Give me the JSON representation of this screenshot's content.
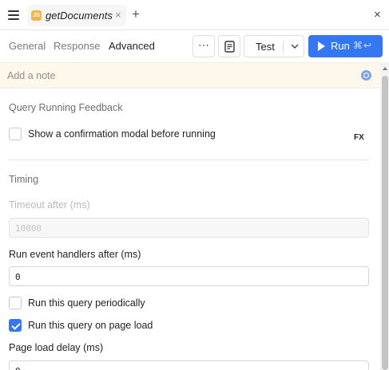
{
  "tab": {
    "badge": "JS",
    "title": "getDocuments",
    "close_glyph": "×",
    "add_glyph": "+",
    "panel_close_glyph": "×"
  },
  "toolbar": {
    "tabs": [
      {
        "label": "General",
        "active": false
      },
      {
        "label": "Response",
        "active": false
      },
      {
        "label": "Advanced",
        "active": true
      }
    ],
    "more_label": "⋯",
    "test_label": "Test",
    "run_label": "Run",
    "run_shortcut": "⌘↩"
  },
  "note": {
    "placeholder": "Add a note"
  },
  "feedback": {
    "title": "Query Running Feedback",
    "confirm_label": "Show a confirmation modal before running",
    "confirm_checked": false,
    "fx_label": "FX"
  },
  "timing": {
    "title": "Timing",
    "timeout_label": "Timeout after (ms)",
    "timeout_value": "10000",
    "handlers_label": "Run event handlers after (ms)",
    "handlers_value": "0",
    "periodic_label": "Run this query periodically",
    "periodic_checked": false,
    "pageload_label": "Run this query on page load",
    "pageload_checked": true,
    "delay_label": "Page load delay (ms)",
    "delay_value": "0"
  },
  "colors": {
    "accent": "#3577f3",
    "note_bg": "#fdf8ea",
    "js_badge": "#f0b54a"
  },
  "icons": {
    "menu": "hamburger-icon",
    "docs": "document-icon",
    "note_action": "note-ai-icon"
  }
}
